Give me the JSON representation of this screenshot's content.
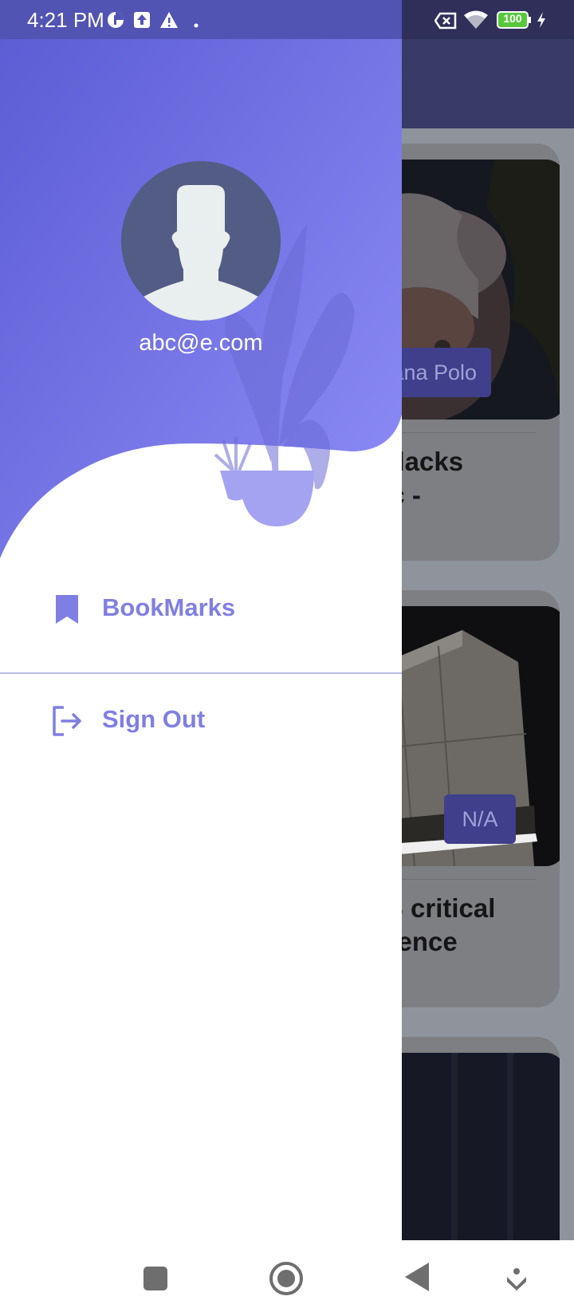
{
  "status_bar": {
    "time": "4:21 PM",
    "battery": "100",
    "icons": [
      "data-saver-icon",
      "upload-icon",
      "warning-icon",
      "dot-icon",
      "no-sim-icon",
      "wifi-icon",
      "battery-icon",
      "charging-icon"
    ]
  },
  "drawer": {
    "email": "abc@e.com",
    "menu": [
      {
        "label": "BookMarks",
        "icon": "bookmark-icon"
      },
      {
        "label": "Sign Out",
        "icon": "sign-out-icon"
      }
    ],
    "accent_color": "#7f7fe3"
  },
  "background_feed": {
    "cards": [
      {
        "badge": "sana Polo",
        "title": "m lacks\npic -"
      },
      {
        "badge": "N/A",
        "title": "US critical\nligence"
      }
    ]
  },
  "nav_bar": {
    "buttons": [
      "recent-apps-icon",
      "home-icon",
      "back-icon",
      "assistant-icon"
    ]
  }
}
